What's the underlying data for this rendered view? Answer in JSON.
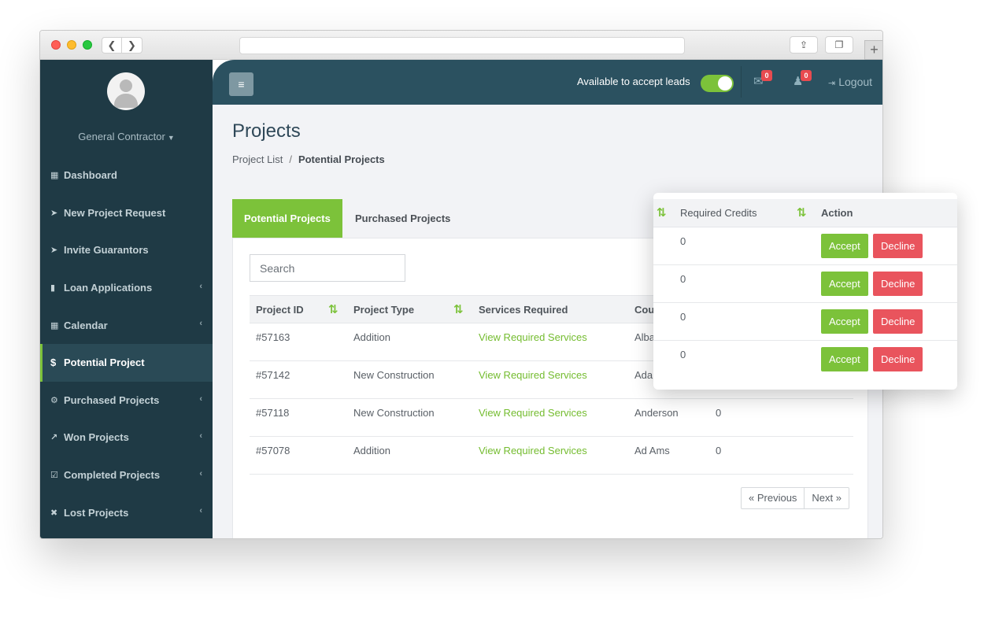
{
  "sidebar": {
    "role": "General Contractor",
    "items": [
      {
        "label": "Dashboard",
        "icon": "▦",
        "chevron": false
      },
      {
        "label": "New Project Request",
        "icon": "➤",
        "chevron": false
      },
      {
        "label": "Invite Guarantors",
        "icon": "➤",
        "chevron": false
      },
      {
        "label": "Loan Applications",
        "icon": "▮",
        "chevron": true
      },
      {
        "label": "Calendar",
        "icon": "▦",
        "chevron": true
      },
      {
        "label": "Potential Project",
        "icon": "$",
        "chevron": false
      },
      {
        "label": "Purchased Projects",
        "icon": "⚙",
        "chevron": true
      },
      {
        "label": "Won Projects",
        "icon": "↗",
        "chevron": true
      },
      {
        "label": "Completed Projects",
        "icon": "☑",
        "chevron": true
      },
      {
        "label": "Lost Projects",
        "icon": "✖",
        "chevron": true
      }
    ],
    "chevron_glyph": "‹"
  },
  "topbar": {
    "menu_glyph": "≡",
    "available_label": "Available to accept leads",
    "available_on": true,
    "mail_count": "0",
    "notification_count": "0",
    "logout_label": "Logout"
  },
  "main": {
    "title": "Projects",
    "breadcrumb": {
      "parent": "Project List",
      "separator": "/",
      "current": "Potential Projects"
    },
    "tabs": [
      "Potential Projects",
      "Purchased Projects"
    ],
    "search_placeholder": "Search",
    "table": {
      "headers": [
        "Project ID",
        "Project Type",
        "Services Required",
        "Cour"
      ],
      "rows": [
        {
          "id": "#57163",
          "type": "Addition",
          "services": "View Required Services",
          "county": "Alba",
          "credits": ""
        },
        {
          "id": "#57142",
          "type": "New Construction",
          "services": "View Required Services",
          "county": "Adar",
          "credits": ""
        },
        {
          "id": "#57118",
          "type": "New Construction",
          "services": "View Required Services",
          "county": "Anderson",
          "credits": "0"
        },
        {
          "id": "#57078",
          "type": "Addition",
          "services": "View Required Services",
          "county": "Ad Ams",
          "credits": "0"
        }
      ]
    },
    "pagination": {
      "previous": "« Previous",
      "next": "Next »"
    }
  },
  "popup": {
    "headers": [
      "Required Credits",
      "Action"
    ],
    "rows": [
      {
        "credits": "0",
        "accept": "Accept",
        "decline": "Decline"
      },
      {
        "credits": "0",
        "accept": "Accept",
        "decline": "Decline"
      },
      {
        "credits": "0",
        "accept": "Accept",
        "decline": "Decline"
      },
      {
        "credits": "0",
        "accept": "Accept",
        "decline": "Decline"
      }
    ]
  },
  "sort_glyph": "⇅",
  "colors": {
    "accent": "#7cc23a",
    "sidebar": "#1f3a45",
    "topbar": "#2b5160",
    "danger": "#e9545d"
  }
}
